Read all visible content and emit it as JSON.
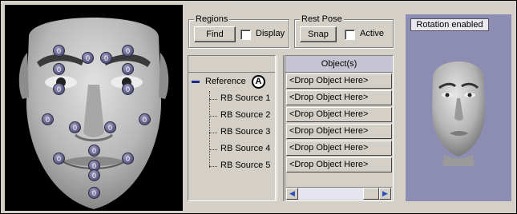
{
  "regions": {
    "title": "Regions",
    "find_label": "Find",
    "display_label": "Display"
  },
  "rest_pose": {
    "title": "Rest Pose",
    "snap_label": "Snap",
    "active_label": "Active"
  },
  "face_markers": [
    "0",
    "0",
    "0",
    "0",
    "0",
    "0",
    "0",
    "0",
    "0",
    "0",
    "0",
    "0",
    "0",
    "0",
    "0",
    "0",
    "0",
    "0"
  ],
  "tree": {
    "items": [
      {
        "label": "Reference"
      },
      {
        "label": "RB Source 1"
      },
      {
        "label": "RB Source 2"
      },
      {
        "label": "RB Source 3"
      },
      {
        "label": "RB Source 4"
      },
      {
        "label": "RB Source 5"
      }
    ],
    "callout": "A"
  },
  "objects": {
    "header": "Object(s)",
    "rows": [
      "<Drop Object Here>",
      "<Drop Object Here>",
      "<Drop Object Here>",
      "<Drop Object Here>",
      "<Drop Object Here>",
      "<Drop Object Here>"
    ]
  },
  "preview": {
    "rotation_label": "Rotation enabled"
  },
  "colors": {
    "panel_bg": "#d4d0c8",
    "viewport_bg": "#000000",
    "preview_bg": "#8d8db4",
    "marker": "#57557e",
    "objects_header": "#c6c3d3",
    "tree_dash": "#1a2a8a"
  }
}
